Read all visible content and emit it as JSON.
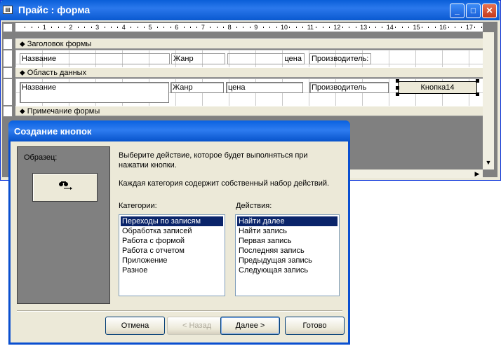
{
  "form_window": {
    "title": "Прайс : форма",
    "minimize": "_",
    "maximize": "□",
    "close": "✕",
    "ruler_numbers": [
      "1",
      "2",
      "3",
      "4",
      "5",
      "6",
      "7",
      "8",
      "9",
      "10",
      "11",
      "12",
      "13",
      "14",
      "15",
      "16",
      "17"
    ],
    "sections": {
      "header": "Заголовок формы",
      "detail": "Область данных",
      "footer": "Примечание формы"
    },
    "header_labels": {
      "name": "Название",
      "genre": "Жанр",
      "price": "цена",
      "producer": "Производитель:"
    },
    "detail_fields": {
      "name": "Название",
      "genre": "Жанр",
      "price": "цена",
      "producer": "Производитель",
      "button": "Кнопка14"
    }
  },
  "dialog": {
    "title": "Создание кнопок",
    "sample_label": "Образец:",
    "sample_icon": "binoculars-arrow-icon",
    "description_line1": "Выберите действие, которое будет выполняться при",
    "description_line2": "нажатии кнопки.",
    "description_line3": "Каждая категория содержит собственный набор действий.",
    "categories_label": "Категории:",
    "actions_label": "Действия:",
    "categories": [
      "Переходы по записям",
      "Обработка записей",
      "Работа с формой",
      "Работа с отчетом",
      "Приложение",
      "Разное"
    ],
    "actions": [
      "Найти далее",
      "Найти запись",
      "Первая запись",
      "Последняя запись",
      "Предыдущая запись",
      "Следующая запись"
    ],
    "selected_category": "Переходы по записям",
    "selected_action": "Найти далее",
    "buttons": {
      "cancel": "Отмена",
      "back": "< Назад",
      "next": "Далее >",
      "finish": "Готово"
    }
  }
}
